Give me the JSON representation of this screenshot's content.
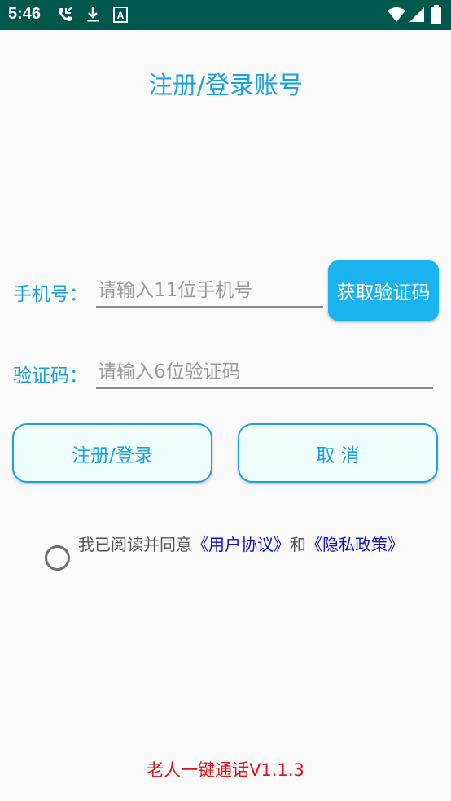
{
  "status_bar": {
    "time": "5:46",
    "left_icons": [
      "missed-call-icon",
      "download-icon",
      "text-a-icon"
    ],
    "right_icons": [
      "wifi-icon",
      "signal-icon",
      "battery-icon"
    ]
  },
  "page": {
    "title": "注册/登录账号"
  },
  "phone": {
    "label": "手机号：",
    "placeholder": "请输入11位手机号",
    "value": ""
  },
  "get_code_button": "获取验证码",
  "code": {
    "label": "验证码：",
    "placeholder": "请输入6位验证码",
    "value": ""
  },
  "buttons": {
    "register_login": "注册/登录",
    "cancel": "取  消"
  },
  "agreement": {
    "prefix": "我已阅读并同意",
    "user_agreement": "《用户协议》",
    "and": "和",
    "privacy_policy": "《隐私政策》",
    "checked": false
  },
  "footer": "老人一键通话V1.1.3",
  "colors": {
    "status_bar": "#00574b",
    "accent": "#1aa3e0",
    "code_button": "#1ab2ef",
    "link": "#1010cc",
    "footer": "#e0131b"
  }
}
